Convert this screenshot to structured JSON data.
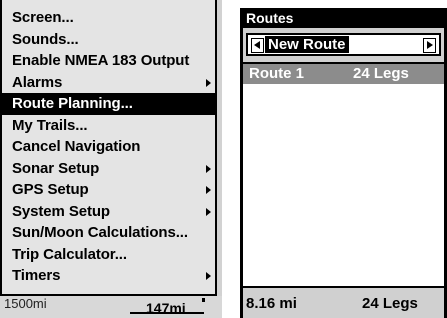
{
  "menu": {
    "items": [
      {
        "label": "Screen...",
        "submenu": false,
        "selected": false
      },
      {
        "label": "Sounds...",
        "submenu": false,
        "selected": false
      },
      {
        "label": "Enable NMEA 183 Output",
        "submenu": false,
        "selected": false
      },
      {
        "label": "Alarms",
        "submenu": true,
        "selected": false
      },
      {
        "label": "Route Planning...",
        "submenu": false,
        "selected": true
      },
      {
        "label": "My Trails...",
        "submenu": false,
        "selected": false
      },
      {
        "label": "Cancel Navigation",
        "submenu": false,
        "selected": false
      },
      {
        "label": "Sonar Setup",
        "submenu": true,
        "selected": false
      },
      {
        "label": "GPS Setup",
        "submenu": true,
        "selected": false
      },
      {
        "label": "System Setup",
        "submenu": true,
        "selected": false
      },
      {
        "label": "Sun/Moon Calculations...",
        "submenu": false,
        "selected": false
      },
      {
        "label": "Trip Calculator...",
        "submenu": false,
        "selected": false
      },
      {
        "label": "Timers",
        "submenu": true,
        "selected": false
      }
    ]
  },
  "map": {
    "scale_left": "1500mi",
    "scale_right": "147mi"
  },
  "routes": {
    "title": "Routes",
    "selector_value": "New Route",
    "list": [
      {
        "name": "Route 1",
        "legs": "24 Legs"
      }
    ],
    "footer_distance": "8.16 mi",
    "footer_legs": "24 Legs"
  },
  "colors": {
    "menu_bg": "#e4e4e4",
    "screen_bg": "#d0d0d0",
    "selection": "#000000",
    "route_highlight": "#8c8c8c"
  },
  "icons": {
    "submenu": "submenu-arrow-icon",
    "selector_prev": "arrow-left-icon",
    "selector_next": "arrow-right-icon"
  }
}
